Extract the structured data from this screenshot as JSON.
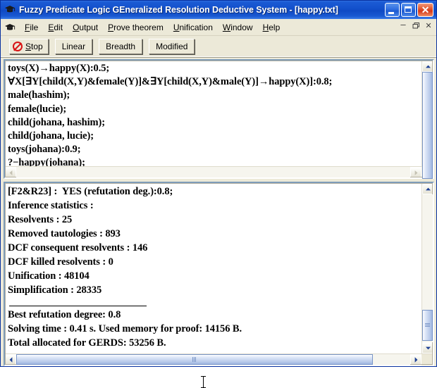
{
  "window": {
    "title": "Fuzzy Predicate Logic GEneralized Resolution Deductive System - [happy.txt]",
    "icon": "graduation-cap-icon",
    "caption_buttons": {
      "minimize": "_",
      "maximize": "□",
      "close": "✕"
    }
  },
  "menubar": {
    "icon": "graduation-cap-icon",
    "items": [
      {
        "label": "File",
        "accel": "F"
      },
      {
        "label": "Edit",
        "accel": "E"
      },
      {
        "label": "Output",
        "accel": "O"
      },
      {
        "label": "Prove theorem",
        "accel": "P"
      },
      {
        "label": "Unification",
        "accel": "U"
      },
      {
        "label": "Window",
        "accel": "W"
      },
      {
        "label": "Help",
        "accel": "H"
      }
    ],
    "mdi_buttons": {
      "minimize": "–",
      "restore": "❐",
      "close": "✕"
    }
  },
  "toolbar": {
    "stop_label": "Stop",
    "stop_icon": "no-entry-icon",
    "buttons": [
      {
        "label": "Linear"
      },
      {
        "label": "Breadth"
      },
      {
        "label": "Modified"
      }
    ]
  },
  "editor": {
    "lines": [
      "toys(X)→happy(X):0.5;",
      "∀X[∃Y[child(X,Y)&female(Y)]&∃Y[child(X,Y)&male(Y)]→happy(X)]:0.8;",
      "male(hashim);",
      "female(lucie);",
      "child(johana, hashim);",
      "child(johana, lucie);",
      "toys(johana):0.9;",
      "?−happy(johana);"
    ]
  },
  "output": {
    "lines_top": [
      "[F2&R23] :  YES (refutation deg.):0.8;",
      "Inference statistics :",
      "Resolvents : 25",
      "Removed tautologies : 893",
      "DCF consequent resolvents : 146",
      "DCF killed resolvents : 0",
      "Unification : 48104",
      "Simplification : 28335"
    ],
    "lines_bottom": [
      "Best refutation degree: 0.8",
      "Solving time : 0.41 s. Used memory for proof: 14156 B.",
      "Total allocated for GERDS: 53256 B."
    ]
  },
  "scrollbars": {
    "up_arrow": "⌃",
    "down_arrow": "⌄",
    "left_arrow": "❮",
    "right_arrow": "❯"
  },
  "colors": {
    "titlebar_blue": "#0f49c4",
    "toolbar_face": "#ece9d8",
    "accent_red": "#d81212",
    "scroll_blue": "#b8caea"
  }
}
